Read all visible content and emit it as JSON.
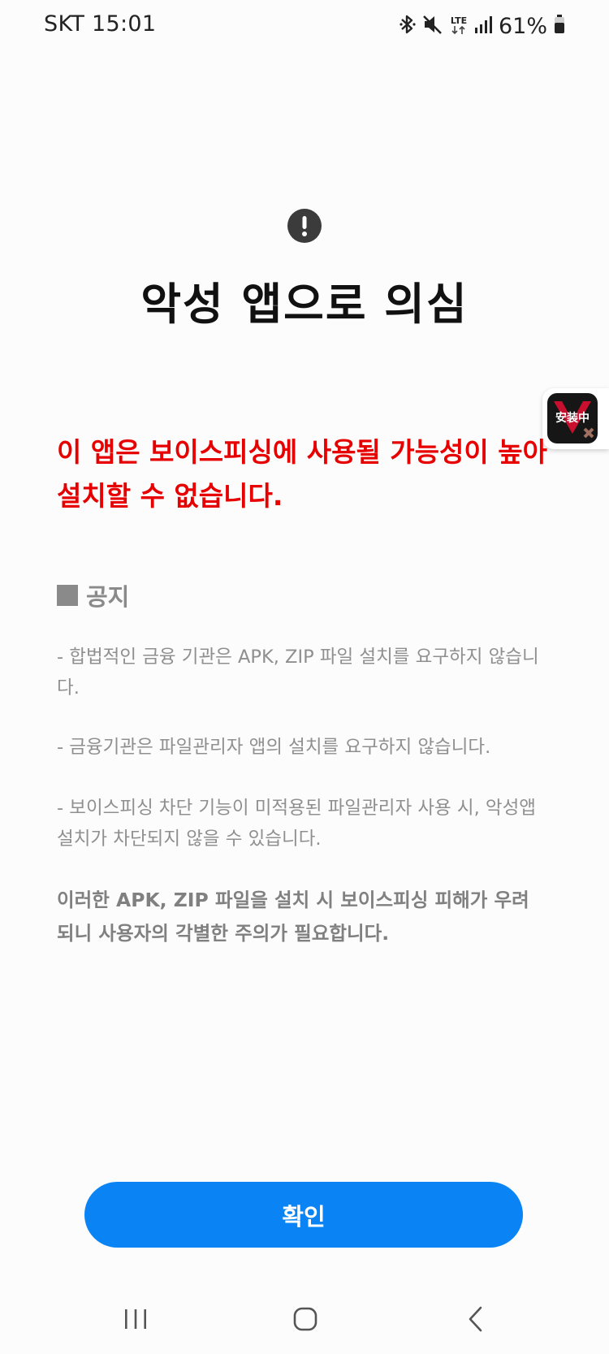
{
  "status_bar": {
    "carrier_time": "SKT 15:01",
    "network_type": "LTE",
    "battery_percent": "61%",
    "icons": [
      "bluetooth-icon",
      "mute-icon",
      "lte-icon",
      "signal-icon",
      "battery-icon"
    ]
  },
  "dialog": {
    "icon": "exclamation-icon",
    "title": "악성 앱으로 의심",
    "warning_message": "이 앱은 보이스피싱에 사용될 가능성이 높아 설치할 수 없습니다.",
    "notice_heading": "공지",
    "notice_items": [
      "- 합법적인 금융 기관은 APK, ZIP 파일 설치를 요구하지 않습니다.",
      "- 금융기관은 파일관리자 앱의 설치를 요구하지 않습니다.",
      "- 보이스피싱 차단 기능이 미적용된 파일관리자 사용 시, 악성앱 설치가 차단되지 않을 수 있습니다."
    ],
    "notice_emphasis": "이러한 APK, ZIP 파일을 설치 시 보이스피싱 피해가 우려되니 사용자의 각별한 주의가 필요합니다.",
    "confirm_label": "확인"
  },
  "floating_badge": {
    "label": "安装中"
  },
  "colors": {
    "warning_red": "#e60000",
    "button_blue": "#0a84f5",
    "notice_gray": "#8f8f8f"
  }
}
